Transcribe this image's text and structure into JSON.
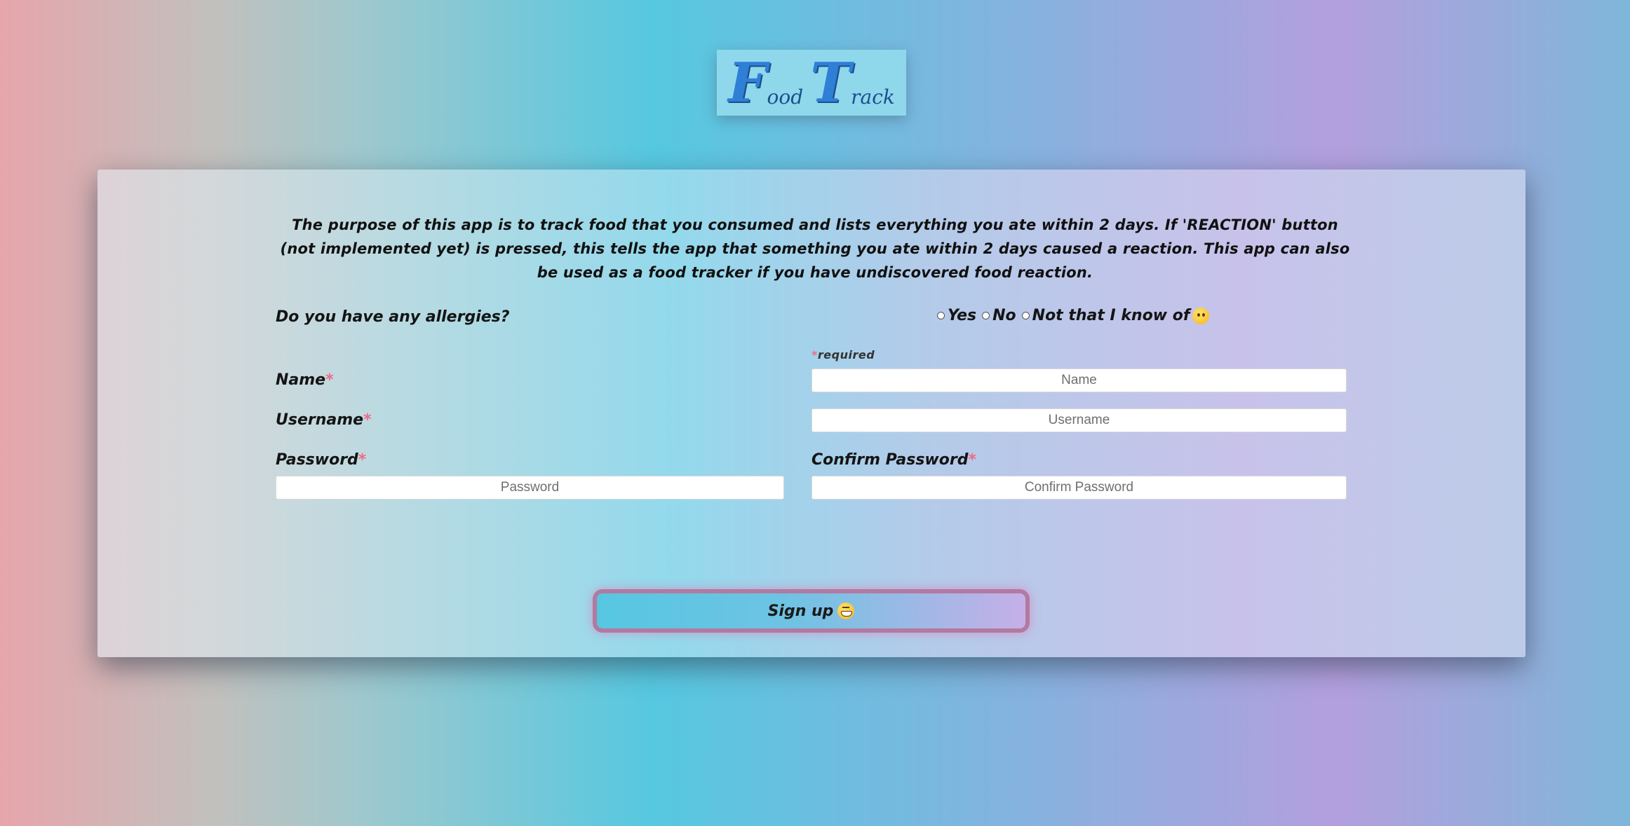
{
  "logo": {
    "first_big": "F",
    "first_small": "ood",
    "second_big": "T",
    "second_small": "rack"
  },
  "intro_text": "The purpose of this app is to track food that you consumed and lists everything you ate within 2 days. If 'REACTION' button (not implemented yet) is pressed, this tells the app that something you ate within 2 days caused a reaction. This app can also be used as a food tracker if you have undiscovered food reaction.",
  "allergies": {
    "question": "Do you have any allergies?",
    "options": [
      "Yes",
      "No",
      "Not that I know of"
    ]
  },
  "required_note": {
    "asterisk": "*",
    "text": "required"
  },
  "fields": {
    "name": {
      "label": "Name",
      "placeholder": "Name"
    },
    "username": {
      "label": "Username",
      "placeholder": "Username"
    },
    "password": {
      "label": "Password",
      "placeholder": "Password"
    },
    "confirm_password": {
      "label": "Confirm Password",
      "placeholder": "Confirm Password"
    },
    "asterisk": "*"
  },
  "signup_button": {
    "label": "Sign up"
  },
  "colors": {
    "accent_asterisk": "#ef6a86",
    "logo_blue": "#2f7fd7",
    "button_border": "#b27aa0"
  }
}
